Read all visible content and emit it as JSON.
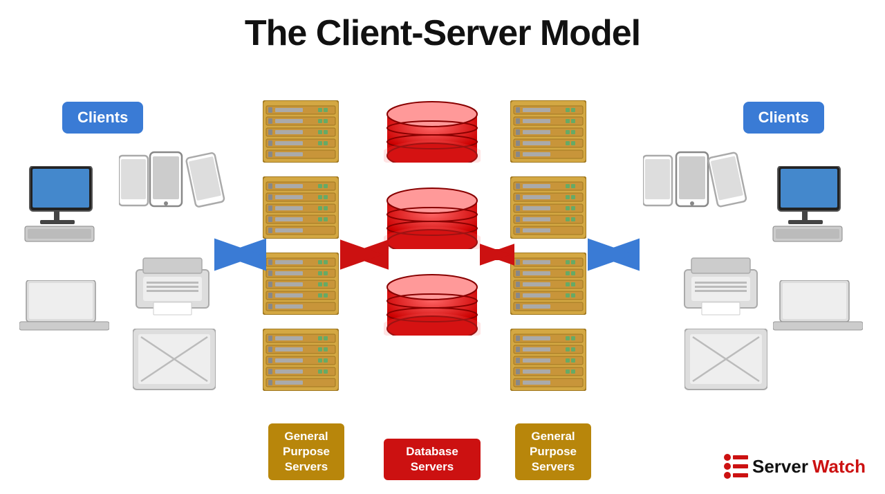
{
  "title": "The Client-Server Model",
  "clients_left": "Clients",
  "clients_right": "Clients",
  "label_gp_left": "General Purpose Servers",
  "label_db": "Database Servers",
  "label_gp_right": "General Purpose Servers",
  "logo_server": "Server",
  "logo_watch": "Watch"
}
